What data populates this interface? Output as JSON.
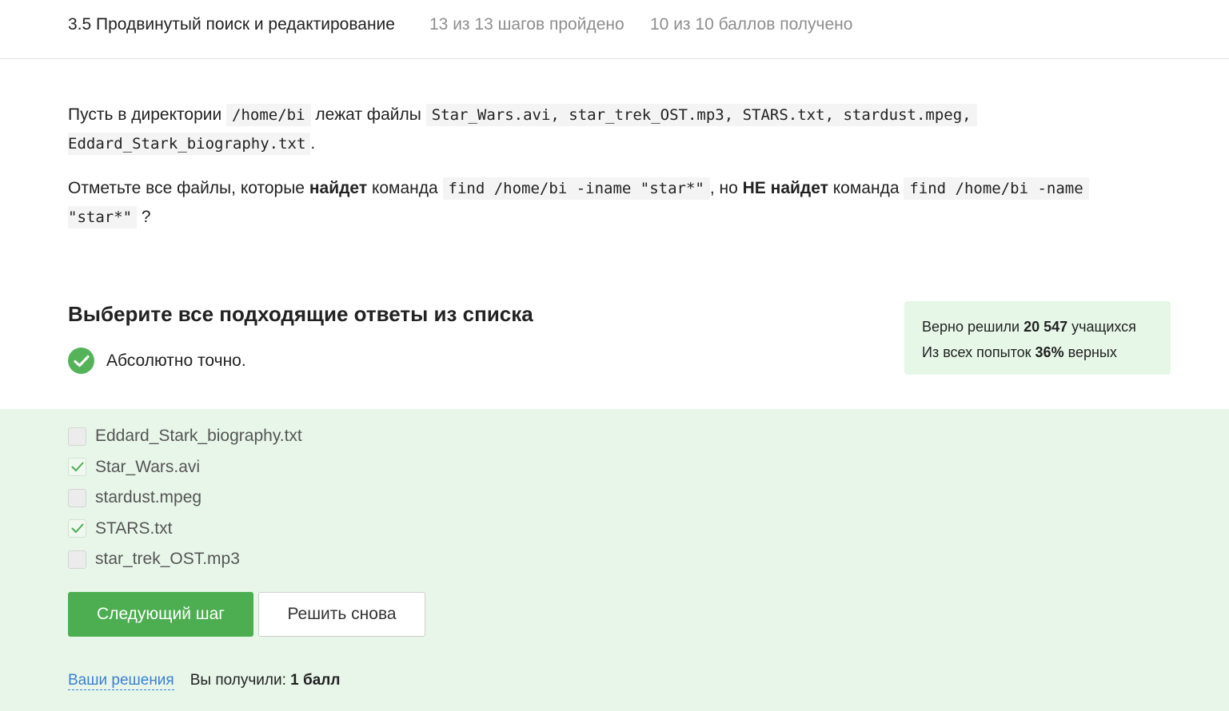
{
  "header": {
    "lesson_title": "3.5 Продвинутый поиск и редактирование",
    "steps_progress": "13 из 13 шагов пройдено",
    "score_progress": "10 из 10 баллов  получено"
  },
  "question": {
    "p1_text1": "Пусть в директории ",
    "p1_code1": "/home/bi",
    "p1_text2": " лежат файлы ",
    "p1_code2": "Star_Wars.avi, star_trek_OST.mp3, STARS.txt, stardust.mpeg,",
    "p1_code3": "Eddard_Stark_biography.txt",
    "p1_text3": ".",
    "p2_text1": "Отметьте все файлы, которые ",
    "p2_bold1": "найдет",
    "p2_text2": " команда ",
    "p2_code1": "find /home/bi -iname \"star*\"",
    "p2_text3": ", но ",
    "p2_bold2": "НЕ найдет",
    "p2_text4": " команда ",
    "p2_code2": "find /home/bi -name",
    "p2_code3": "\"star*\"",
    "p2_text5": " ?"
  },
  "task": {
    "heading": "Выберите все подходящие ответы из списка",
    "feedback": "Абсолютно точно."
  },
  "stats": {
    "solved_prefix": "Верно решили ",
    "solved_count": "20 547",
    "solved_suffix": " учащихся",
    "attempts_prefix": "Из всех попыток ",
    "attempts_percent": "36%",
    "attempts_suffix": " верных"
  },
  "options": [
    {
      "label": "Eddard_Stark_biography.txt",
      "checked": false
    },
    {
      "label": "Star_Wars.avi",
      "checked": true
    },
    {
      "label": "stardust.mpeg",
      "checked": false
    },
    {
      "label": "STARS.txt",
      "checked": true
    },
    {
      "label": "star_trek_OST.mp3",
      "checked": false
    }
  ],
  "buttons": {
    "next": "Следующий шаг",
    "retry": "Решить снова"
  },
  "footer": {
    "solutions_link": "Ваши решения",
    "got_prefix": "Вы получили: ",
    "got_value": "1 балл"
  },
  "colors": {
    "accent_green": "#4cae50",
    "panel_green": "#e8f6e9",
    "link_blue": "#3b7fd0"
  }
}
